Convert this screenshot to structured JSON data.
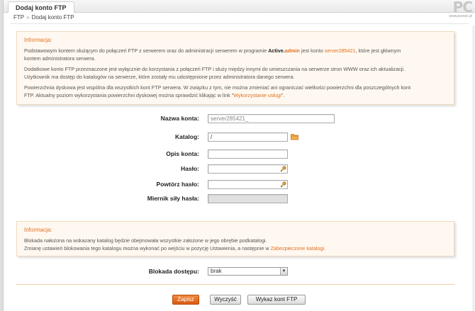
{
  "window": {
    "tab_title": "Dodaj konto FTP"
  },
  "watermark": {
    "logo": "PC",
    "url": "www.purepc.pl"
  },
  "breadcrumb": {
    "root": "FTP",
    "separator": "»",
    "current": "Dodaj konto FTP"
  },
  "info_top": {
    "header": "Informacja:",
    "p1_a": "Podstawowym kontem służącym do połączeń FTP z serwerem oraz do administracji serwerem w programie ",
    "p1_brand_a": "Active.",
    "p1_brand_b": "admin",
    "p1_b": " jest konto ",
    "p1_account": "server285421",
    "p1_c": ", które jest głównym",
    "p1_d": "kontem administratora serwera.",
    "p2": "Dodatkowe konto FTP przeznaczone jest wyłącznie do korzystania z połączeń FTP i służy między innymi do umieszczania na serwerze stron WWW oraz ich aktualizacji.",
    "p2b": "Użytkownik ma dostęp do katalogów na serwerze, które zostały mu udostępnione przez administratora danego serwera.",
    "p3": "Powierzchnia dyskowa jest wspólna dla wszystkich kont FTP serwera. W związku z tym, nie można zmieniać ani ograniczać wielkości powierzchni dla poszczególnych kont",
    "p3b_a": "FTP. Aktualny poziom wykorzystania powierzchni dyskowej można sprawdzić klikając w link \"",
    "p3b_link": "Wykorzystanie usługi",
    "p3b_b": "\"."
  },
  "form": {
    "account_name_label": "Nazwa konta:",
    "account_name_value": "server285421_",
    "directory_label": "Katalog:",
    "directory_value": "/",
    "description_label": "Opis konta:",
    "description_value": "",
    "password_label": "Hasło:",
    "password_repeat_label": "Powtórz hasło:",
    "strength_label": "Miernik siły hasła:"
  },
  "info_bottom": {
    "header": "Informacja:",
    "p1": "Blokada nałożona na wskazany katalog będzie obejmowała wszystkie założone w jego obrębie podkatalogi.",
    "p2_a": "Zmianę ustawień blokowania tego katalogu można wykonać po wejściu w pozycję Ustawienia, a następnie w ",
    "p2_link": "Zabezpieczone katalogi",
    "p2_b": "."
  },
  "access_lock": {
    "label": "Blokada dostępu:",
    "selected": "brak"
  },
  "buttons": {
    "save": "Zapisz",
    "clear": "Wyczyść",
    "list": "Wykaz kont FTP"
  },
  "colors": {
    "accent": "#e07020",
    "info_bg": "#fff8f0",
    "primary_button": "#e06a1c"
  }
}
